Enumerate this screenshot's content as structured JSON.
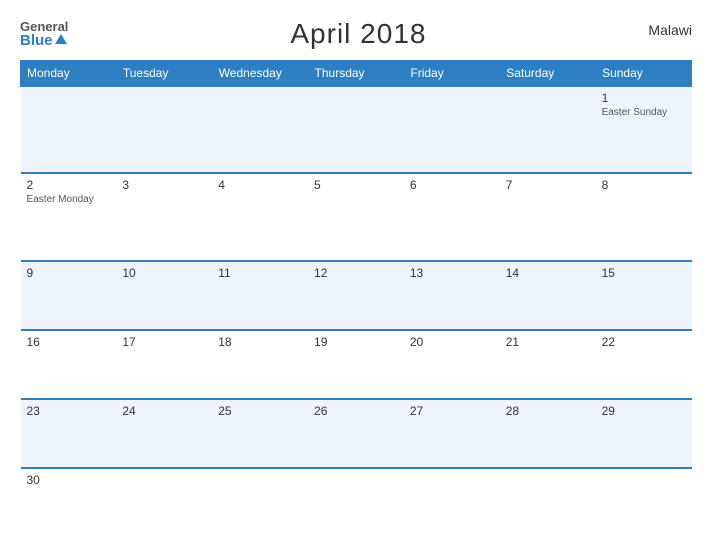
{
  "header": {
    "logo_general": "General",
    "logo_blue": "Blue",
    "title": "April 2018",
    "country": "Malawi"
  },
  "days_of_week": [
    "Monday",
    "Tuesday",
    "Wednesday",
    "Thursday",
    "Friday",
    "Saturday",
    "Sunday"
  ],
  "weeks": [
    [
      {
        "date": "",
        "holiday": ""
      },
      {
        "date": "",
        "holiday": ""
      },
      {
        "date": "",
        "holiday": ""
      },
      {
        "date": "",
        "holiday": ""
      },
      {
        "date": "",
        "holiday": ""
      },
      {
        "date": "",
        "holiday": ""
      },
      {
        "date": "1",
        "holiday": "Easter Sunday"
      }
    ],
    [
      {
        "date": "2",
        "holiday": "Easter Monday"
      },
      {
        "date": "3",
        "holiday": ""
      },
      {
        "date": "4",
        "holiday": ""
      },
      {
        "date": "5",
        "holiday": ""
      },
      {
        "date": "6",
        "holiday": ""
      },
      {
        "date": "7",
        "holiday": ""
      },
      {
        "date": "8",
        "holiday": ""
      }
    ],
    [
      {
        "date": "9",
        "holiday": ""
      },
      {
        "date": "10",
        "holiday": ""
      },
      {
        "date": "11",
        "holiday": ""
      },
      {
        "date": "12",
        "holiday": ""
      },
      {
        "date": "13",
        "holiday": ""
      },
      {
        "date": "14",
        "holiday": ""
      },
      {
        "date": "15",
        "holiday": ""
      }
    ],
    [
      {
        "date": "16",
        "holiday": ""
      },
      {
        "date": "17",
        "holiday": ""
      },
      {
        "date": "18",
        "holiday": ""
      },
      {
        "date": "19",
        "holiday": ""
      },
      {
        "date": "20",
        "holiday": ""
      },
      {
        "date": "21",
        "holiday": ""
      },
      {
        "date": "22",
        "holiday": ""
      }
    ],
    [
      {
        "date": "23",
        "holiday": ""
      },
      {
        "date": "24",
        "holiday": ""
      },
      {
        "date": "25",
        "holiday": ""
      },
      {
        "date": "26",
        "holiday": ""
      },
      {
        "date": "27",
        "holiday": ""
      },
      {
        "date": "28",
        "holiday": ""
      },
      {
        "date": "29",
        "holiday": ""
      }
    ],
    [
      {
        "date": "30",
        "holiday": ""
      },
      {
        "date": "",
        "holiday": ""
      },
      {
        "date": "",
        "holiday": ""
      },
      {
        "date": "",
        "holiday": ""
      },
      {
        "date": "",
        "holiday": ""
      },
      {
        "date": "",
        "holiday": ""
      },
      {
        "date": "",
        "holiday": ""
      }
    ]
  ]
}
